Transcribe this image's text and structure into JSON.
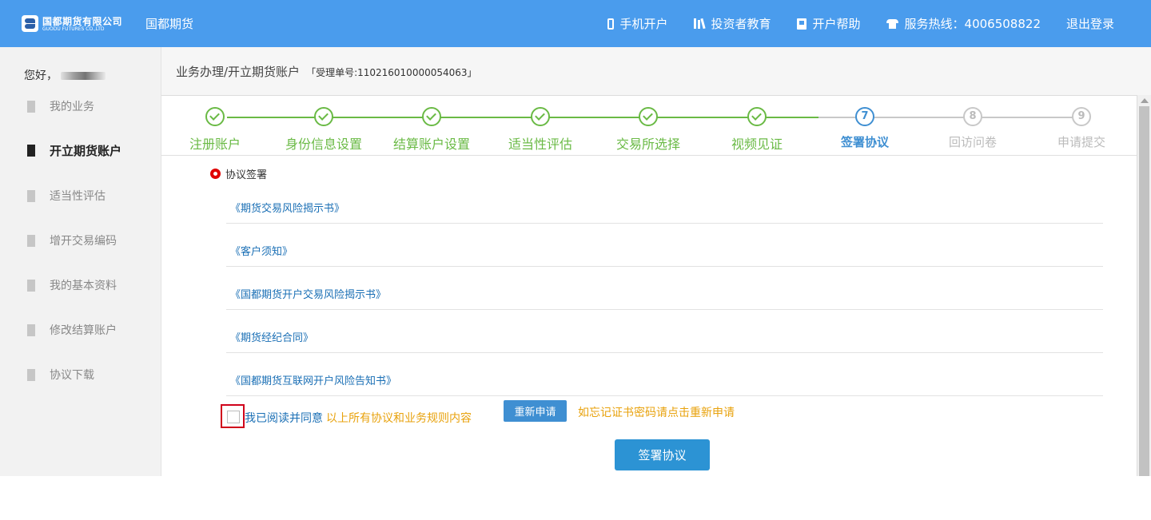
{
  "header": {
    "logo_cn": "国都期货有限公司",
    "logo_en": "GUODU FUTURES CO.,LTD",
    "brand": "国都期货",
    "nav": [
      {
        "icon": "phone-icon",
        "label": "手机开户"
      },
      {
        "icon": "books-icon",
        "label": "投资者教育"
      },
      {
        "icon": "book-icon",
        "label": "开户帮助"
      },
      {
        "icon": "telephone-icon",
        "label": "服务热线：4006508822"
      },
      {
        "icon": "",
        "label": "退出登录"
      }
    ],
    "bg_color": "#4a9ced"
  },
  "sidebar": {
    "greeting": "您好，",
    "items": [
      {
        "label": "我的业务",
        "active": false
      },
      {
        "label": "开立期货账户",
        "active": true
      },
      {
        "label": "适当性评估",
        "active": false
      },
      {
        "label": "增开交易编码",
        "active": false
      },
      {
        "label": "我的基本资料",
        "active": false
      },
      {
        "label": "修改结算账户",
        "active": false
      },
      {
        "label": "协议下载",
        "active": false
      }
    ]
  },
  "breadcrumb": {
    "path": "业务办理/开立期货账户",
    "receipt": "「受理单号:110216010000054063」"
  },
  "steps": [
    {
      "num": "1",
      "label": "注册账户",
      "state": "done"
    },
    {
      "num": "2",
      "label": "身份信息设置",
      "state": "done"
    },
    {
      "num": "3",
      "label": "结算账户设置",
      "state": "done"
    },
    {
      "num": "4",
      "label": "适当性评估",
      "state": "done"
    },
    {
      "num": "5",
      "label": "交易所选择",
      "state": "done"
    },
    {
      "num": "6",
      "label": "视频见证",
      "state": "done"
    },
    {
      "num": "7",
      "label": "签署协议",
      "state": "current"
    },
    {
      "num": "8",
      "label": "回访问卷",
      "state": "todo"
    },
    {
      "num": "9",
      "label": "申请提交",
      "state": "todo"
    }
  ],
  "section": {
    "title": "协议签署",
    "documents": [
      "《期货交易风险揭示书》",
      "《客户须知》",
      "《国都期货开户交易风险揭示书》",
      "《期货经纪合同》",
      "《国都期货互联网开户风险告知书》"
    ],
    "agree_text": "我已阅读并同意",
    "agree_suffix": "以上所有协议和业务规则内容",
    "reapply_label": "重新申请",
    "hint": "如忘记证书密码请点击重新申请",
    "sign_label": "签署协议"
  },
  "colors": {
    "done": "#6aba45",
    "current": "#3f8fd2",
    "todo": "#c8c8c8",
    "link": "#1a6fb5",
    "warning": "#e8a20c"
  }
}
